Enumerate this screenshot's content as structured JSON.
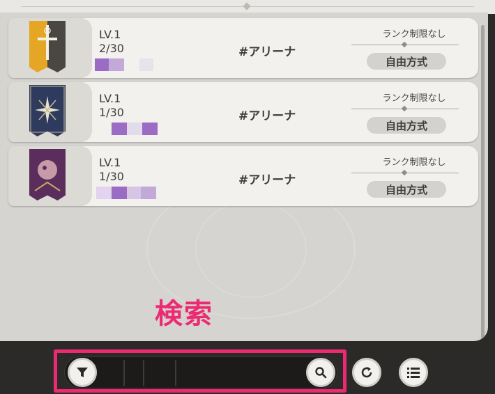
{
  "rooms": [
    {
      "level": "LV.1",
      "players": "2/30",
      "tag": "#アリーナ",
      "rank": "ランク制限なし",
      "mode": "自由方式",
      "banner_icon": "sword-icon",
      "banner_color": "#e5a625"
    },
    {
      "level": "LV.1",
      "players": "1/30",
      "tag": "#アリーナ",
      "rank": "ランク制限なし",
      "mode": "自由方式",
      "banner_icon": "star-icon",
      "banner_color": "#2e3b5e"
    },
    {
      "level": "LV.1",
      "players": "1/30",
      "tag": "#アリーナ",
      "rank": "ランク制限なし",
      "mode": "自由方式",
      "banner_icon": "beast-icon",
      "banner_color": "#5a2d5c"
    }
  ],
  "annotation": {
    "search_label": "検索"
  },
  "toolbar": {
    "filter_icon": "filter-icon",
    "search_icon": "search-icon",
    "refresh_icon": "refresh-icon",
    "list_icon": "list-icon"
  },
  "colors": {
    "highlight": "#ec2a72",
    "blur_purple": "#9b6cc4"
  }
}
